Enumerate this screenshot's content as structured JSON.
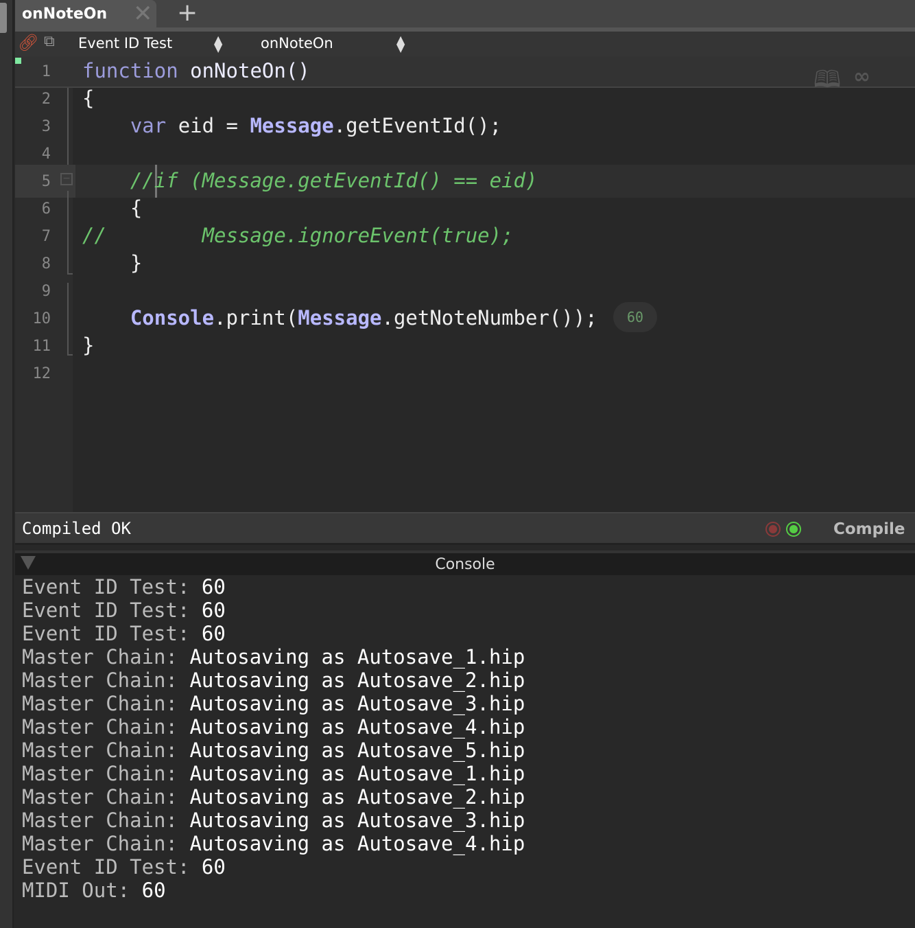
{
  "tab": {
    "title": "onNoteOn"
  },
  "toolbar": {
    "processor": "Event ID Test",
    "callback": "onNoteOn"
  },
  "editor": {
    "line_numbers": [
      "1",
      "2",
      "3",
      "4",
      "5",
      "6",
      "7",
      "8",
      "9",
      "10",
      "11",
      "12"
    ],
    "lines": [
      [
        {
          "t": "kw",
          "v": "function "
        },
        {
          "t": "fn",
          "v": "onNoteOn()"
        }
      ],
      [
        {
          "t": "",
          "v": "{"
        }
      ],
      [
        {
          "t": "",
          "v": "    "
        },
        {
          "t": "kw",
          "v": "var"
        },
        {
          "t": "",
          "v": " eid = "
        },
        {
          "t": "obj",
          "v": "Message"
        },
        {
          "t": "",
          "v": ".getEventId();"
        }
      ],
      [],
      [
        {
          "t": "",
          "v": "    "
        },
        {
          "t": "cm",
          "v": "//if (Message.getEventId() == eid)"
        }
      ],
      [
        {
          "t": "",
          "v": "    {"
        }
      ],
      [
        {
          "t": "cm",
          "v": "//        Message.ignoreEvent(true);"
        }
      ],
      [
        {
          "t": "",
          "v": "    }"
        }
      ],
      [],
      [
        {
          "t": "",
          "v": "    "
        },
        {
          "t": "obj",
          "v": "Console"
        },
        {
          "t": "",
          "v": ".print("
        },
        {
          "t": "obj",
          "v": "Message"
        },
        {
          "t": "",
          "v": ".getNoteNumber());"
        }
      ],
      [
        {
          "t": "",
          "v": "}"
        }
      ],
      []
    ],
    "inline_value": "60"
  },
  "status": {
    "message": "Compiled OK",
    "compile_label": "Compile"
  },
  "console": {
    "title": "Console",
    "lines": [
      {
        "src": "Event ID Test:",
        "msg": "60"
      },
      {
        "src": "Event ID Test:",
        "msg": "60"
      },
      {
        "src": "Event ID Test:",
        "msg": "60"
      },
      {
        "src": "Master Chain:",
        "msg": "Autosaving as Autosave_1.hip"
      },
      {
        "src": "Master Chain:",
        "msg": "Autosaving as Autosave_2.hip"
      },
      {
        "src": "Master Chain:",
        "msg": "Autosaving as Autosave_3.hip"
      },
      {
        "src": "Master Chain:",
        "msg": "Autosaving as Autosave_4.hip"
      },
      {
        "src": "Master Chain:",
        "msg": "Autosaving as Autosave_5.hip"
      },
      {
        "src": "Master Chain:",
        "msg": "Autosaving as Autosave_1.hip"
      },
      {
        "src": "Master Chain:",
        "msg": "Autosaving as Autosave_2.hip"
      },
      {
        "src": "Master Chain:",
        "msg": "Autosaving as Autosave_3.hip"
      },
      {
        "src": "Master Chain:",
        "msg": "Autosaving as Autosave_4.hip"
      },
      {
        "src": "Event ID Test:",
        "msg": "60"
      },
      {
        "src": "MIDI Out:",
        "msg": "60"
      }
    ]
  },
  "colors": {
    "keyword": "#9c9cdc",
    "object": "#b8b8ff",
    "comment": "#6cc46c",
    "ok": "#55cc44",
    "error": "#8a3a3a"
  }
}
